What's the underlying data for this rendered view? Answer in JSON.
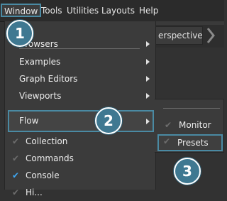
{
  "menubar": {
    "items": [
      "Window",
      "Tools",
      "Utilities",
      "Layouts",
      "Help"
    ],
    "active": "Window"
  },
  "toolbar": {
    "perspective_tab": "erspective"
  },
  "window_menu": {
    "items": [
      {
        "label": "Browsers",
        "submenu": true
      },
      {
        "label": "Examples",
        "submenu": true
      },
      {
        "label": "Graph Editors",
        "submenu": true
      },
      {
        "label": "Viewports",
        "submenu": true
      },
      {
        "label": "Flow",
        "submenu": true,
        "highlighted": true
      },
      {
        "label": "Collection",
        "check": "dim"
      },
      {
        "label": "Commands",
        "check": "dim"
      },
      {
        "label": "Console",
        "check": "checked"
      },
      {
        "label": "Hi...",
        "check": "dim"
      }
    ]
  },
  "flow_submenu": {
    "items": [
      {
        "label": "Monitor",
        "check": "dim"
      },
      {
        "label": "Presets",
        "check": "dim",
        "highlighted": true
      }
    ]
  },
  "callouts": [
    "1",
    "2",
    "3"
  ],
  "colors": {
    "highlight": "#4a8aa3",
    "checked": "#3fa9f5",
    "callout": "#3f7891"
  },
  "icons": {
    "checkmark": "check-icon",
    "submenu_arrow": "chevron-right-icon"
  }
}
